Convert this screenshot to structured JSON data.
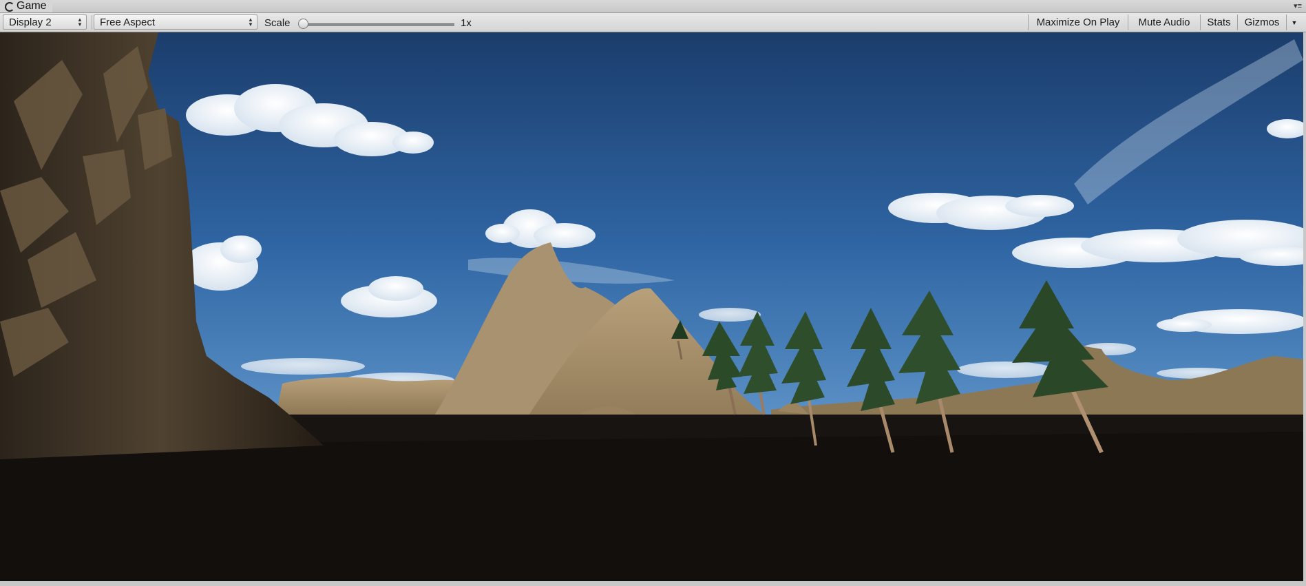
{
  "tab": {
    "title": "Game",
    "icon": "unity-logo-icon",
    "menu_icon": "tab-menu-icon"
  },
  "toolbar": {
    "display_select": "Display 2",
    "aspect_select": "Free Aspect",
    "scale_label": "Scale",
    "scale_value": "1x",
    "maximize_label": "Maximize On Play",
    "mute_label": "Mute Audio",
    "stats_label": "Stats",
    "gizmos_label": "Gizmos"
  },
  "colors": {
    "sky_top": "#1c3f6e",
    "sky_horizon": "#4f86be",
    "ground": "#151311",
    "terrain": "#a7906b"
  }
}
